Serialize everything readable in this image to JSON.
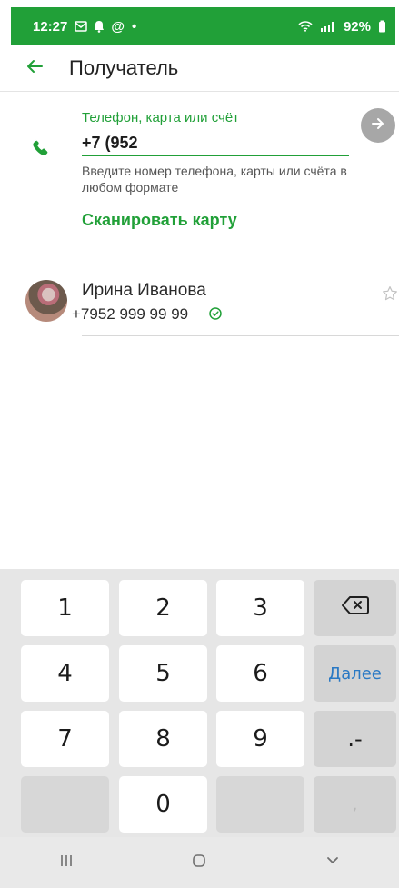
{
  "status_bar": {
    "time": "12:27",
    "battery": "92%"
  },
  "header": {
    "title": "Получатель"
  },
  "recipient": {
    "field_label": "Телефон, карта или счёт",
    "field_value": "+7 (952",
    "hint": "Введите номер телефона, карты или счёта в любом формате",
    "scan_label": "Сканировать карту"
  },
  "contact": {
    "name": "Ирина Иванова",
    "phone": "+7952 999 99 99"
  },
  "keyboard": {
    "keys": {
      "one": "1",
      "two": "2",
      "three": "3",
      "four": "4",
      "five": "5",
      "six": "6",
      "seven": "7",
      "eight": "8",
      "nine": "9",
      "zero": "0",
      "next": "Далее",
      "punct": ".-",
      "comma": ","
    }
  },
  "icons": {
    "back": "arrow-left-icon",
    "phone": "phone-icon",
    "go": "arrow-right-icon",
    "verified": "verified-check-icon",
    "favorite": "star-outline-icon",
    "backspace": "backspace-icon",
    "recent_apps": "recent-apps-icon",
    "home": "home-icon",
    "hide_keyboard": "chevron-down-icon"
  },
  "colors": {
    "accent": "#21a038",
    "action_blue": "#2a79c4",
    "keyboard_bg": "#e6e6e6"
  }
}
